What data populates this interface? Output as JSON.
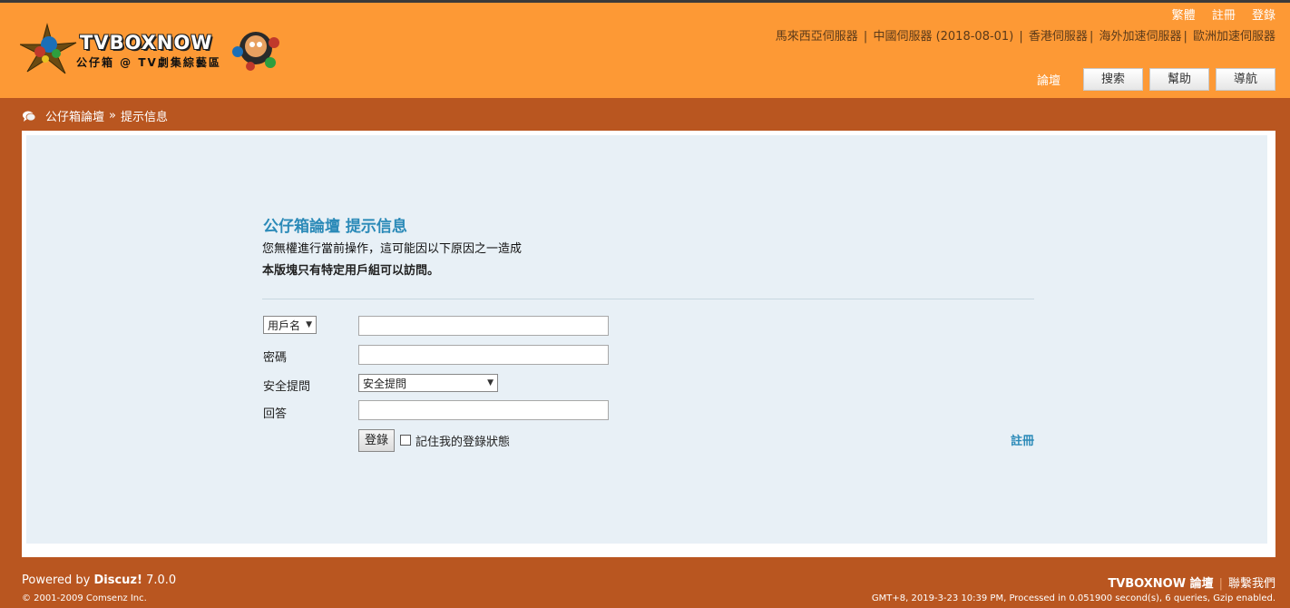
{
  "header": {
    "logo_title": "TVBOXNOW",
    "logo_subtitle": "公仔箱 @ TV劇集綜藝區",
    "top_links": [
      "繁體",
      "註冊",
      "登錄"
    ],
    "servers": [
      "馬來西亞伺服器",
      "中國伺服器 (2018-08-01)",
      "香港伺服器",
      "海外加速伺服器",
      "歐洲加速伺服器"
    ],
    "menu_text": "論壇",
    "menu_buttons": [
      "搜索",
      "幫助",
      "導航"
    ]
  },
  "breadcrumb": {
    "home": "公仔箱論壇",
    "arrow": "»",
    "current": "提示信息"
  },
  "message": {
    "title": "公仔箱論壇 提示信息",
    "line": "您無權進行當前操作，這可能因以下原因之一造成",
    "reason": "本版塊只有特定用戶組可以訪問。"
  },
  "form": {
    "username_select": "用戶名",
    "username_value": "",
    "password_label": "密碼",
    "password_value": "",
    "question_label": "安全提問",
    "question_select": "安全提問",
    "answer_label": "回答",
    "answer_value": "",
    "login_button": "登錄",
    "remember_label": "記住我的登錄狀態",
    "register_link": "註冊"
  },
  "footer": {
    "powered_prefix": "Powered by ",
    "powered_name": "Discuz!",
    "powered_version": " 7.0.0",
    "copyright": "© 2001-2009 Comsenz Inc.",
    "site_name": "TVBOXNOW 論壇",
    "contact": "聯繫我們",
    "stats": "GMT+8, 2019-3-23 10:39 PM, Processed in 0.051900 second(s), 6 queries, Gzip enabled."
  },
  "colors": {
    "header_bg": "#fd9935",
    "page_bg": "#b95620",
    "panel_bg": "#e8f0f6",
    "accent": "#2b8ab8"
  }
}
